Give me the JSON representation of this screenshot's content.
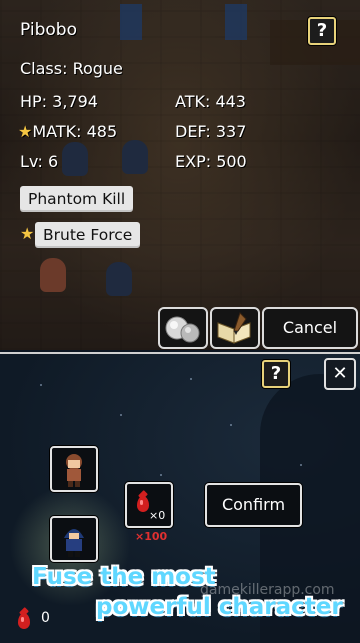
{
  "character": {
    "name": "Pibobo",
    "class": "Class: Rogue",
    "hp": "HP: 3,794",
    "atk": "ATK: 443",
    "matk": "MATK: 485",
    "def": "DEF: 337",
    "lv": "Lv: 6",
    "exp": "EXP: 500"
  },
  "skills": [
    {
      "label": "Phantom Kill",
      "starred": false
    },
    {
      "label": "Brute Force",
      "starred": true
    }
  ],
  "top_actions": {
    "help_label": "?",
    "cancel_label": "Cancel",
    "orb_icon": "orb-pair-icon",
    "book_icon": "spellbook-icon"
  },
  "fusion": {
    "help_label": "?",
    "close_label": "✕",
    "material_count": "×0",
    "material_cost": "×100",
    "confirm_label": "Confirm",
    "currency_count": "0"
  },
  "promo": {
    "line1": "Fuse the most",
    "line2": "powerful character"
  },
  "watermark": "gamekillerapp.com",
  "colors": {
    "accent_gold": "#e8d27a",
    "star": "#f4c542",
    "gem_red": "#d21f1f",
    "promo_cyan": "#5fd7ff"
  }
}
